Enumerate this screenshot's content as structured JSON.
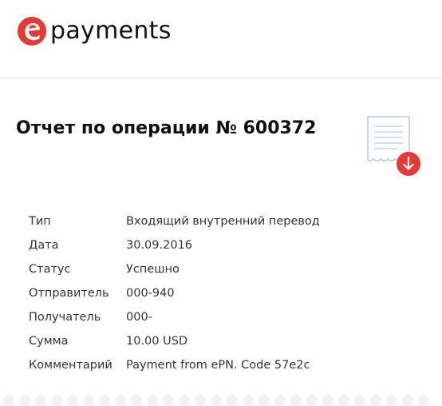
{
  "brand": {
    "name": "payments",
    "accent": "#e53935"
  },
  "report": {
    "title": "Отчет по операции № 600372",
    "icon": "receipt-download-icon"
  },
  "details": [
    {
      "label": "Тип",
      "value": "Входящий внутренний перевод"
    },
    {
      "label": "Дата",
      "value": "30.09.2016"
    },
    {
      "label": "Статус",
      "value": "Успешно"
    },
    {
      "label": "Отправитель",
      "value": "000-940"
    },
    {
      "label": "Получатель",
      "value": "000-"
    },
    {
      "label": "Сумма",
      "value": "10.00 USD"
    },
    {
      "label": "Комментарий",
      "value": "Payment from ePN. Code 57e2c"
    }
  ]
}
